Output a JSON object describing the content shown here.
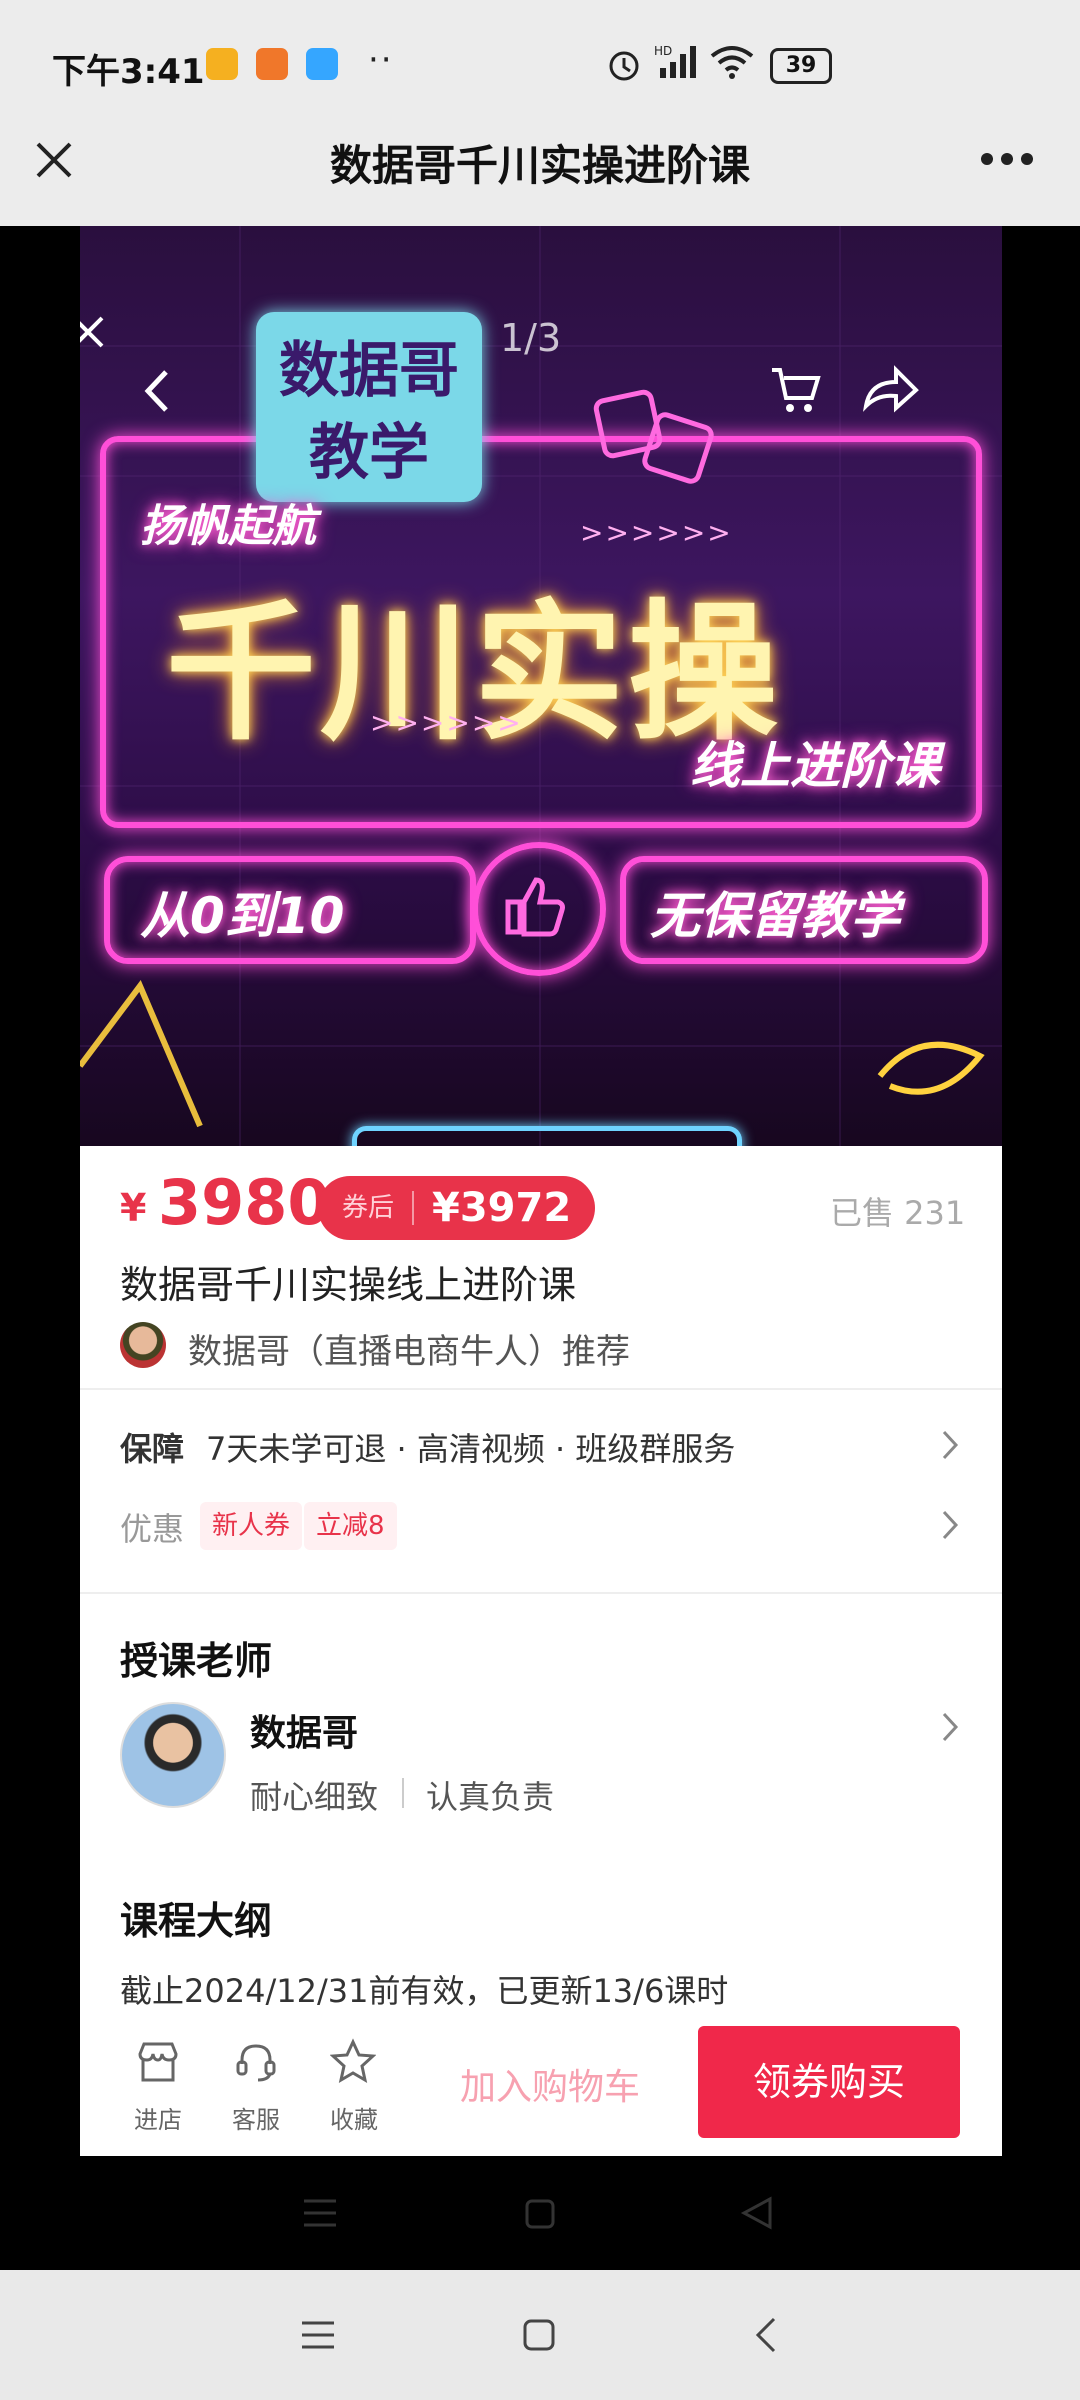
{
  "status_bar": {
    "time": "下午3:41",
    "dots": "··",
    "battery": "39"
  },
  "title_bar": {
    "title": "数据哥千川实操进阶课"
  },
  "banner": {
    "page_indicator": "1/3",
    "badge_line1": "数据哥",
    "badge_line2": "教学",
    "slogan": "扬帆起航",
    "arrows1": ">>>>>>",
    "main_title": "千川实操",
    "arrows2": ">>>>>>",
    "subtitle": "线上进阶课",
    "left_pill": "从0到10",
    "right_pill": "无保留教学"
  },
  "price": {
    "symbol": "¥",
    "amount": "3980",
    "coupon_label": "券后",
    "coupon_price": "¥3972",
    "sold": "已售 231"
  },
  "product": {
    "title": "数据哥千川实操线上进阶课",
    "recommend": "数据哥（直播电商牛人）推荐"
  },
  "guarantee": {
    "label": "保障",
    "text": "7天未学可退 · 高清视频 · 班级群服务"
  },
  "discount": {
    "label": "优惠",
    "tag1": "新人券",
    "tag2": "立减8"
  },
  "teacher": {
    "section_title": "授课老师",
    "name": "数据哥",
    "tag1": "耐心细致",
    "tag2": "认真负责"
  },
  "outline": {
    "section_title": "课程大纲",
    "text": "截止2024/12/31前有效，已更新13/6课时"
  },
  "bottom": {
    "store": "进店",
    "service": "客服",
    "favorite": "收藏",
    "add_cart": "加入购物车",
    "buy": "领券购买"
  },
  "colors": {
    "accent": "#e8334a",
    "buy": "#f0284a",
    "neon_pink": "#ff4fd8"
  }
}
